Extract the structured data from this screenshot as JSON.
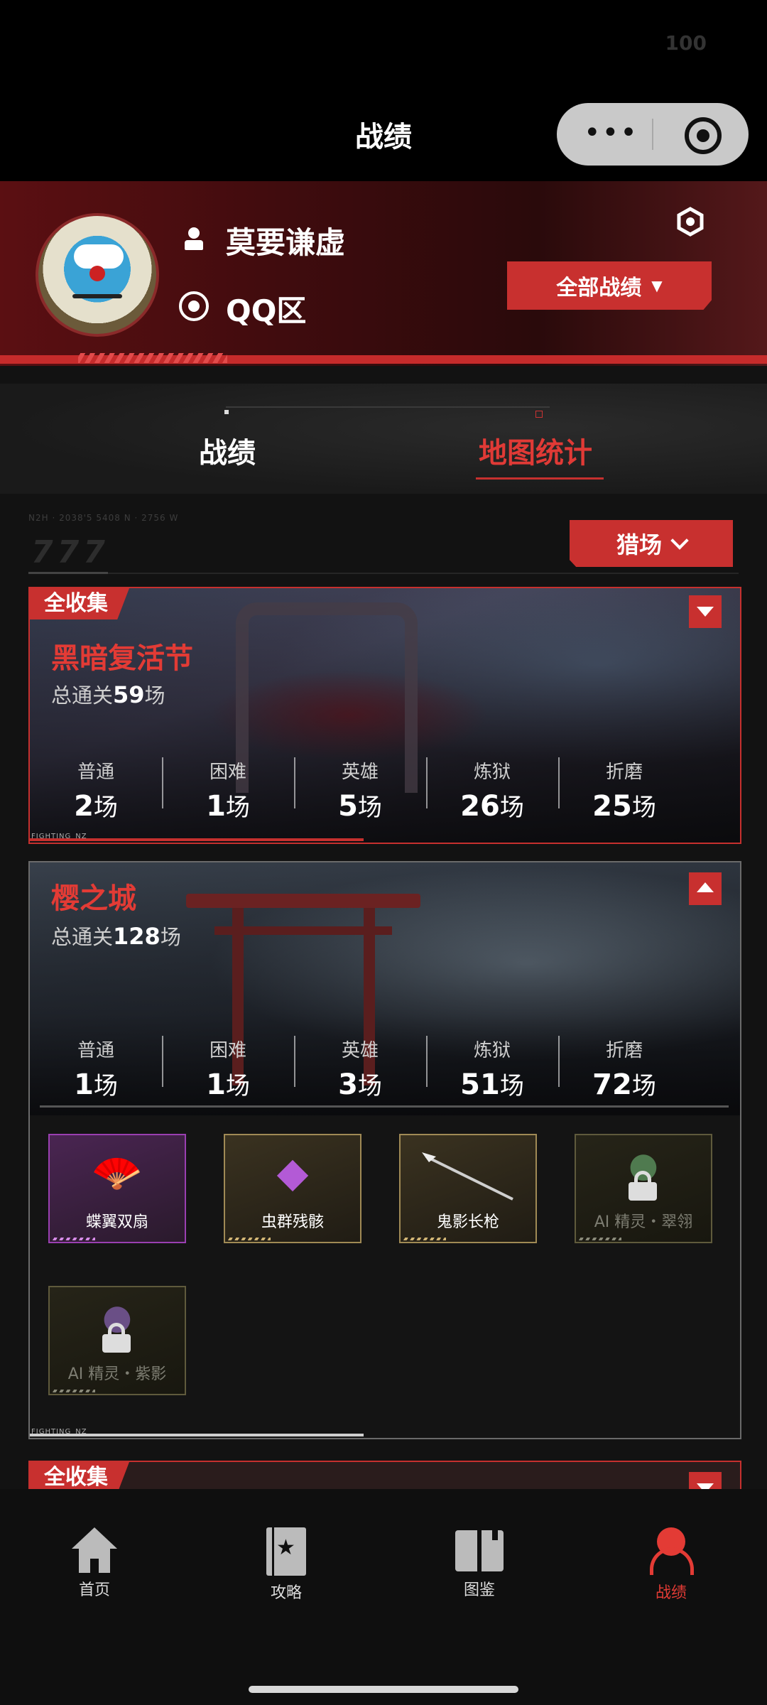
{
  "status_bar": {
    "battery": "100"
  },
  "header": {
    "title": "战绩"
  },
  "profile": {
    "username": "莫要谦虚",
    "zone": "QQ区",
    "filter_button": "全部战绩"
  },
  "tabs": [
    {
      "label": "战绩",
      "active": false
    },
    {
      "label": "地图统计",
      "active": true
    }
  ],
  "filter": {
    "deco_text": "N2H · 2038'5 5408 N · 2756 W",
    "deco_marks": "777",
    "mode": "猎场"
  },
  "maps": [
    {
      "badge": "全收集",
      "name": "黑暗复活节",
      "total_prefix": "总通关",
      "total": "59",
      "total_suffix": "场",
      "expanded": false,
      "stats": [
        {
          "label": "普通",
          "value": "2",
          "unit": "场"
        },
        {
          "label": "困难",
          "value": "1",
          "unit": "场"
        },
        {
          "label": "英雄",
          "value": "5",
          "unit": "场"
        },
        {
          "label": "炼狱",
          "value": "26",
          "unit": "场"
        },
        {
          "label": "折磨",
          "value": "25",
          "unit": "场"
        }
      ],
      "footer_tag": "FIGHTING_NZ"
    },
    {
      "badge": "",
      "name": "樱之城",
      "total_prefix": "总通关",
      "total": "128",
      "total_suffix": "场",
      "expanded": true,
      "stats": [
        {
          "label": "普通",
          "value": "1",
          "unit": "场"
        },
        {
          "label": "困难",
          "value": "1",
          "unit": "场"
        },
        {
          "label": "英雄",
          "value": "3",
          "unit": "场"
        },
        {
          "label": "炼狱",
          "value": "51",
          "unit": "场"
        },
        {
          "label": "折磨",
          "value": "72",
          "unit": "场"
        }
      ],
      "items": [
        {
          "name": "蝶翼双扇",
          "rarity": "purple",
          "locked": false,
          "icon": "fan-icon"
        },
        {
          "name": "虫群残骸",
          "rarity": "gold",
          "locked": false,
          "icon": "crystal-icon"
        },
        {
          "name": "鬼影长枪",
          "rarity": "gold",
          "locked": false,
          "icon": "spear-icon"
        },
        {
          "name": "AI 精灵・翠翎",
          "rarity": "locked",
          "locked": true,
          "icon": "lock-icon"
        },
        {
          "name": "AI 精灵・紫影",
          "rarity": "locked",
          "locked": true,
          "icon": "lock-icon"
        }
      ],
      "footer_tag": "FIGHTING_NZ"
    },
    {
      "badge": "全收集",
      "expanded": false
    }
  ],
  "bottom_nav": [
    {
      "label": "首页",
      "icon": "home-icon",
      "active": false
    },
    {
      "label": "攻略",
      "icon": "guide-icon",
      "active": false
    },
    {
      "label": "图鉴",
      "icon": "book-icon",
      "active": false
    },
    {
      "label": "战绩",
      "icon": "user-icon",
      "active": true
    }
  ],
  "colors": {
    "accent": "#c8302f",
    "accent_text": "#e33b35",
    "background": "#121212"
  }
}
